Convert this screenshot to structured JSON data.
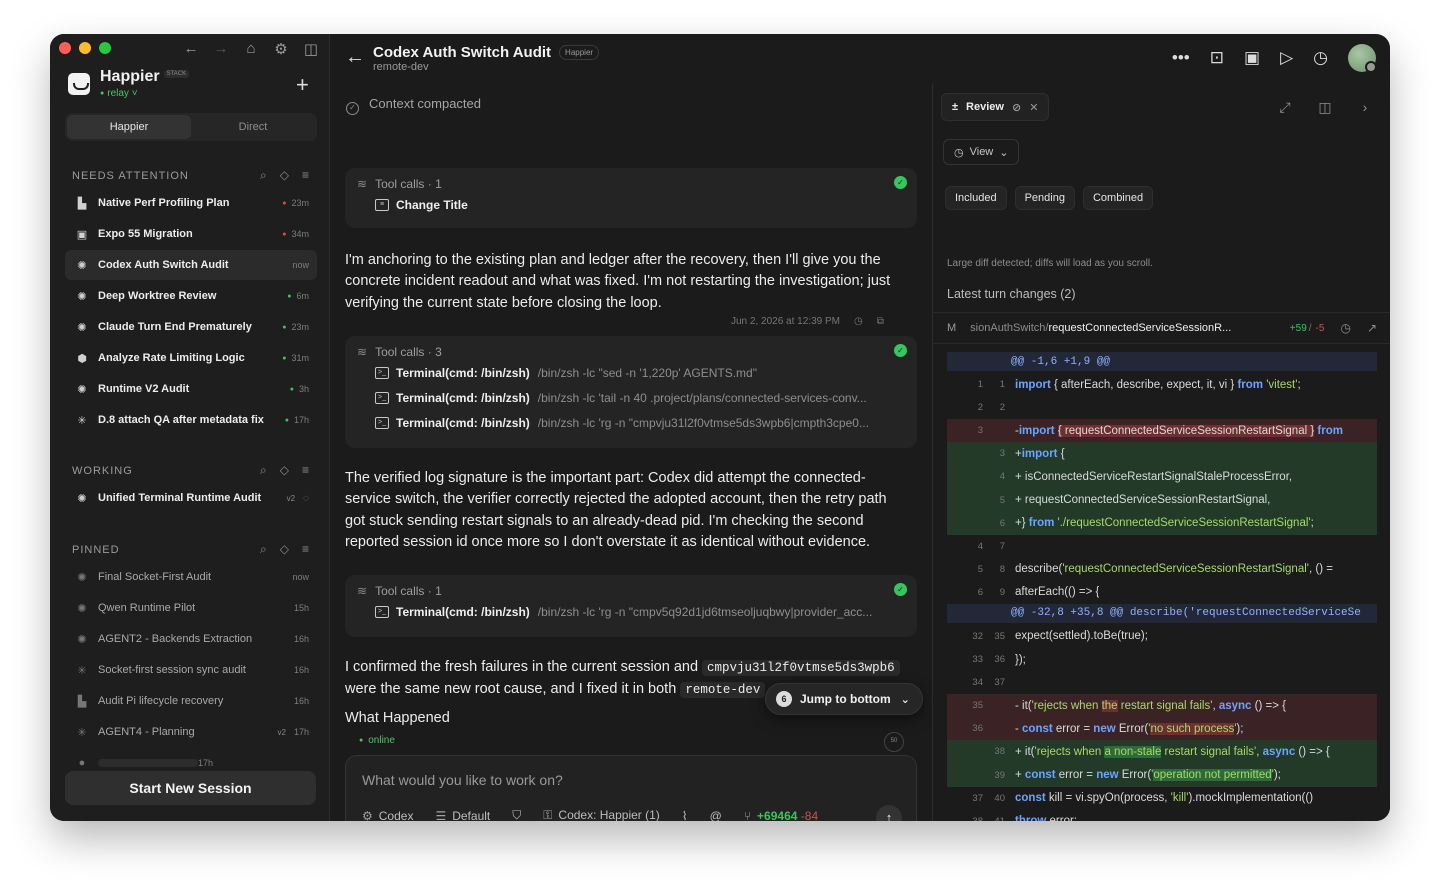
{
  "window": {
    "traffic_colors": [
      "#ff5f57",
      "#febc2e",
      "#28c840"
    ]
  },
  "sidebar": {
    "brand": {
      "name": "Happier",
      "badge": "STACK",
      "status": "relay"
    },
    "tabs": [
      "Happier",
      "Direct"
    ],
    "sections": {
      "needs_attention": {
        "title": "NEEDS ATTENTION",
        "items": [
          {
            "label": "Native Perf Profiling Plan",
            "time": "23m",
            "dot": "#e5484d",
            "icon": "puzzle-icon"
          },
          {
            "label": "Expo 55 Migration",
            "time": "34m",
            "dot": "#e5484d",
            "icon": "square-icon"
          },
          {
            "label": "Codex Auth Switch Audit",
            "time": "now",
            "dot": "",
            "icon": "openai-icon"
          },
          {
            "label": "Deep Worktree Review",
            "time": "6m",
            "dot": "#37c55f",
            "icon": "openai-icon"
          },
          {
            "label": "Claude Turn End Prematurely",
            "time": "23m",
            "dot": "#37c55f",
            "icon": "openai-icon"
          },
          {
            "label": "Analyze Rate Limiting Logic",
            "time": "31m",
            "dot": "#37c55f",
            "icon": "cube-icon"
          },
          {
            "label": "Runtime V2 Audit",
            "time": "3h",
            "dot": "#37c55f",
            "icon": "openai-icon"
          },
          {
            "label": "D.8 attach QA after metadata fix",
            "time": "17h",
            "dot": "#37c55f",
            "icon": "asterisk-icon"
          }
        ]
      },
      "working": {
        "title": "WORKING",
        "items": [
          {
            "label": "Unified Terminal Runtime Audit",
            "badge": "v2",
            "icon": "openai-icon"
          }
        ]
      },
      "pinned": {
        "title": "PINNED",
        "items": [
          {
            "label": "Final Socket-First Audit",
            "time": "now",
            "icon": "openai-icon"
          },
          {
            "label": "Qwen Runtime Pilot",
            "time": "15h",
            "icon": "openai-icon"
          },
          {
            "label": "AGENT2 - Backends Extraction",
            "time": "16h",
            "icon": "openai-icon"
          },
          {
            "label": "Socket-first session sync audit",
            "time": "16h",
            "icon": "asterisk-icon"
          },
          {
            "label": "Audit Pi lifecycle recovery",
            "time": "16h",
            "icon": "puzzle-icon"
          },
          {
            "label": "AGENT4 - Planning",
            "time": "17h",
            "badge": "v2",
            "icon": "asterisk-icon"
          },
          {
            "label": "",
            "time": "17h",
            "icon": "circle-icon"
          }
        ]
      }
    },
    "start_button": "Start New Session"
  },
  "header": {
    "title": "Codex Auth Switch Audit",
    "badge": "Happier",
    "subtitle": "remote-dev"
  },
  "chat": {
    "context_compacted": "Context compacted",
    "tool_card_1": {
      "head": "Tool calls · 1",
      "rows": [
        {
          "name": "Change Title",
          "cmd": ""
        }
      ]
    },
    "para_1": "I'm anchoring to the existing plan and ledger after the recovery, then I'll give you the concrete incident readout and what was fixed. I'm not restarting the investigation; just verifying the current state before closing the loop.",
    "timestamp": "Jun 2, 2026 at 12:39 PM",
    "tool_card_2": {
      "head": "Tool calls · 3",
      "rows": [
        {
          "name": "Terminal(cmd: /bin/zsh)",
          "cmd": "/bin/zsh -lc \"sed -n '1,220p' AGENTS.md\""
        },
        {
          "name": "Terminal(cmd: /bin/zsh)",
          "cmd": "/bin/zsh -lc 'tail -n 40 .project/plans/connected-services-conv..."
        },
        {
          "name": "Terminal(cmd: /bin/zsh)",
          "cmd": "/bin/zsh -lc 'rg -n \"cmpvju31l2f0vtmse5ds3wpb6|cmpth3cpe0..."
        }
      ]
    },
    "para_2": "The verified log signature is the important part: Codex did attempt the connected-service switch, the verifier correctly rejected the adopted account, then the retry path got stuck sending restart signals to an already-dead pid. I'm checking the second reported session id once more so I don't overstate it as identical without evidence.",
    "tool_card_3": {
      "head": "Tool calls · 1",
      "rows": [
        {
          "name": "Terminal(cmd: /bin/zsh)",
          "cmd": "/bin/zsh -lc 'rg -n \"cmpv5q92d1jd6tmseoljuqbwy|provider_acc..."
        }
      ]
    },
    "para_3_a": "I confirmed the fresh failures in the current session and",
    "para_3_code_1": "cmpvju31l2f0vtmse5ds3wpb6",
    "para_3_b": "were the same new root cause, and I fixed it in both",
    "para_3_code_2": "remote-dev",
    "para_4": "What Happened",
    "jump": {
      "count": "6",
      "label": "Jump to bottom"
    },
    "online": "online",
    "counter": "50",
    "composer": {
      "placeholder": "What would you like to work on?",
      "agent": "Codex",
      "mode": "Default",
      "profile": "Codex: Happier (1)",
      "diff_add": "+69464",
      "diff_del": "-84"
    }
  },
  "review": {
    "tab": "Review",
    "view": "View",
    "filters": [
      "Included",
      "Pending",
      "Combined"
    ],
    "note": "Large diff detected; diffs will load as you scroll.",
    "latest": "Latest turn changes (2)",
    "file": {
      "status": "M",
      "dir": "sionAuthSwitch/",
      "name": "requestConnectedServiceSessionR...",
      "add": "+59",
      "del": "-5"
    },
    "diff": [
      {
        "type": "hunk",
        "text": "@@ -1,6 +1,9 @@"
      },
      {
        "type": "ctx",
        "old": "1",
        "new": "1",
        "html": "<span class='kw'>import</span> { afterEach, describe, expect, it, vi } <span class='kw'>from</span> <span class='str'>'vitest'</span>;"
      },
      {
        "type": "ctx",
        "old": "2",
        "new": "2",
        "html": ""
      },
      {
        "type": "del",
        "old": "3",
        "new": "",
        "html": "-<span class='kw'>import</span> <span class='hl-del'>{ requestConnectedServiceSessionRestartSignal }</span> <span class='kw'>from</span>"
      },
      {
        "type": "add",
        "old": "",
        "new": "3",
        "html": "+<span class='kw'>import</span> {"
      },
      {
        "type": "add",
        "old": "",
        "new": "4",
        "html": "+  isConnectedServiceRestartSignalStaleProcessError,"
      },
      {
        "type": "add",
        "old": "",
        "new": "5",
        "html": "+  requestConnectedServiceSessionRestartSignal,"
      },
      {
        "type": "add",
        "old": "",
        "new": "6",
        "html": "+} <span class='kw'>from</span> <span class='str'>'./requestConnectedServiceSessionRestartSignal'</span>;"
      },
      {
        "type": "ctx",
        "old": "4",
        "new": "7",
        "html": ""
      },
      {
        "type": "ctx",
        "old": "5",
        "new": "8",
        "html": "describe(<span class='str'>'requestConnectedServiceSessionRestartSignal'</span>, () ="
      },
      {
        "type": "ctx",
        "old": "6",
        "new": "9",
        "html": "  afterEach(() => {"
      },
      {
        "type": "hunk",
        "text": "@@ -32,8 +35,8 @@ describe('requestConnectedServiceSe"
      },
      {
        "type": "ctx",
        "old": "32",
        "new": "35",
        "html": "    expect(settled).toBe(true);"
      },
      {
        "type": "ctx",
        "old": "33",
        "new": "36",
        "html": "    });"
      },
      {
        "type": "ctx",
        "old": "34",
        "new": "37",
        "html": ""
      },
      {
        "type": "del",
        "old": "35",
        "new": "",
        "html": "-  it(<span class='str'>'rejects when <span class='hl-del'>the</span> restart signal fails'</span>, <span class='kw'>async</span> () => {"
      },
      {
        "type": "del",
        "old": "36",
        "new": "",
        "html": "-    <span class='kw'>const</span> error = <span class='kw'>new</span> Error(<span class='str'>'<span class='hl-del'>no such process</span>'</span>);"
      },
      {
        "type": "add",
        "old": "",
        "new": "38",
        "html": "+  it(<span class='str'>'rejects when <span class='hl-add'>a non-stale</span> restart signal fails'</span>, <span class='kw'>async</span> () => {"
      },
      {
        "type": "add",
        "old": "",
        "new": "39",
        "html": "+    <span class='kw'>const</span> error = <span class='kw'>new</span> Error(<span class='str'>'<span class='hl-add'>operation not permitted</span>'</span>);"
      },
      {
        "type": "ctx",
        "old": "37",
        "new": "40",
        "html": "    <span class='kw'>const</span> kill = vi.spyOn(process, <span class='str'>'kill'</span>).mockImplementation(()"
      },
      {
        "type": "ctx",
        "old": "38",
        "new": "41",
        "html": "      <span class='kw'>throw</span> error;"
      },
      {
        "type": "ctx",
        "old": "39",
        "new": "42",
        "html": "    });"
      }
    ]
  }
}
